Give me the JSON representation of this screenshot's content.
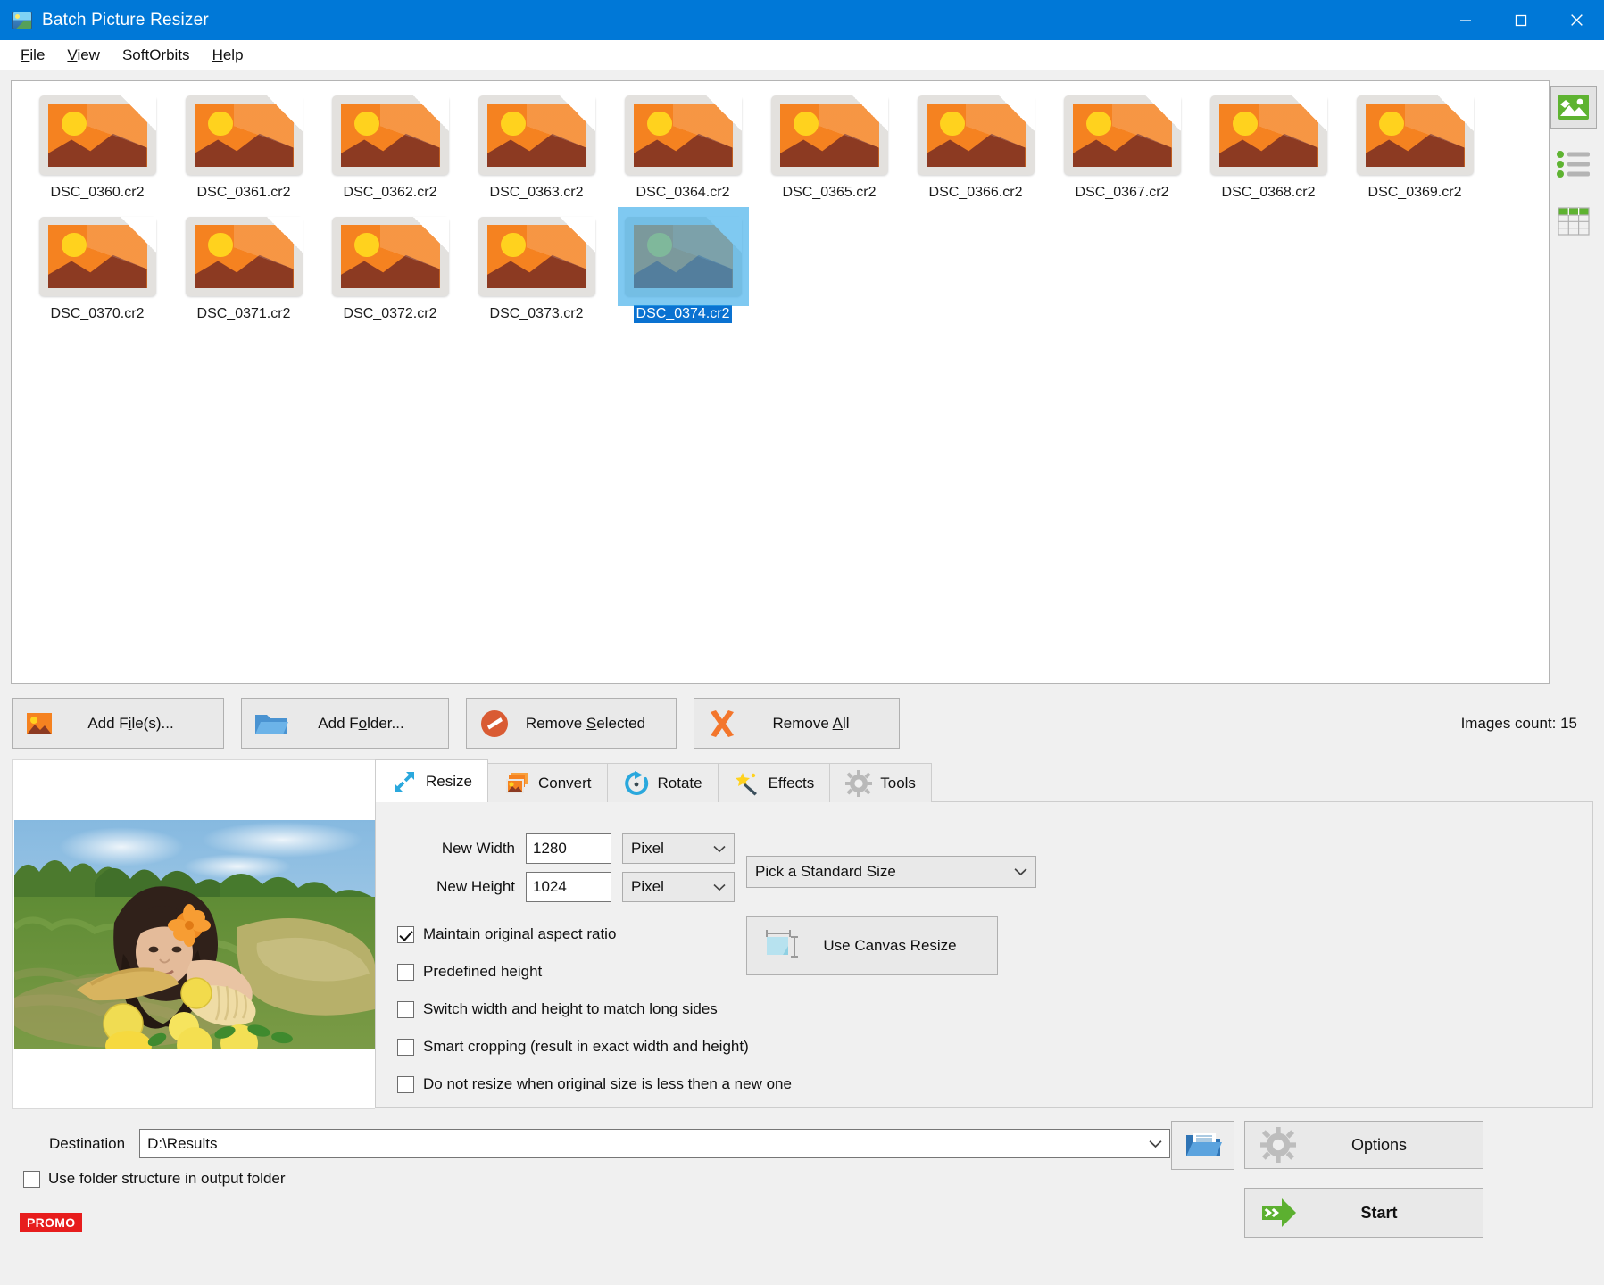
{
  "window": {
    "title": "Batch Picture Resizer",
    "app_icon": "app-picture-icon",
    "minimize": "minimize-icon",
    "maximize": "maximize-icon",
    "close": "close-icon"
  },
  "menu": {
    "items": [
      {
        "label": "File",
        "accel": "F"
      },
      {
        "label": "View",
        "accel": "V"
      },
      {
        "label": "SoftOrbits",
        "accel": ""
      },
      {
        "label": "Help",
        "accel": "H"
      }
    ]
  },
  "thumbnails": {
    "items": [
      {
        "label": "DSC_0360.cr2",
        "selected": false
      },
      {
        "label": "DSC_0361.cr2",
        "selected": false
      },
      {
        "label": "DSC_0362.cr2",
        "selected": false
      },
      {
        "label": "DSC_0363.cr2",
        "selected": false
      },
      {
        "label": "DSC_0364.cr2",
        "selected": false
      },
      {
        "label": "DSC_0365.cr2",
        "selected": false
      },
      {
        "label": "DSC_0366.cr2",
        "selected": false
      },
      {
        "label": "DSC_0367.cr2",
        "selected": false
      },
      {
        "label": "DSC_0368.cr2",
        "selected": false
      },
      {
        "label": "DSC_0369.cr2",
        "selected": false
      },
      {
        "label": "DSC_0370.cr2",
        "selected": false
      },
      {
        "label": "DSC_0371.cr2",
        "selected": false
      },
      {
        "label": "DSC_0372.cr2",
        "selected": false
      },
      {
        "label": "DSC_0373.cr2",
        "selected": false
      },
      {
        "label": "DSC_0374.cr2",
        "selected": true
      }
    ]
  },
  "view_modes": [
    {
      "name": "thumbnail-view",
      "icon": "image-icon",
      "active": true
    },
    {
      "name": "list-view",
      "icon": "list-icon",
      "active": false
    },
    {
      "name": "details-view",
      "icon": "table-icon",
      "active": false
    }
  ],
  "actions": {
    "add_files": "Add File(s)...",
    "add_folder": "Add Folder...",
    "remove_selected": "Remove Selected",
    "remove_all": "Remove All",
    "images_count": "Images count: 15"
  },
  "tabs": [
    {
      "label": "Resize",
      "icon": "resize-arrows-icon",
      "active": true
    },
    {
      "label": "Convert",
      "icon": "convert-images-icon",
      "active": false
    },
    {
      "label": "Rotate",
      "icon": "rotate-icon",
      "active": false
    },
    {
      "label": "Effects",
      "icon": "magic-wand-icon",
      "active": false
    },
    {
      "label": "Tools",
      "icon": "gear-icon",
      "active": false
    }
  ],
  "resize_panel": {
    "new_width_label": "New Width",
    "new_width_value": "1280",
    "new_width_unit": "Pixel",
    "new_height_label": "New Height",
    "new_height_value": "1024",
    "new_height_unit": "Pixel",
    "standard_size": "Pick a Standard Size",
    "canvas_resize": "Use Canvas Resize",
    "checkboxes": [
      {
        "label": "Maintain original aspect ratio",
        "checked": true
      },
      {
        "label": "Predefined height",
        "checked": false
      },
      {
        "label": "Switch width and height to match long sides",
        "checked": false
      },
      {
        "label": "Smart cropping (result in exact width and height)",
        "checked": false
      },
      {
        "label": "Do not resize when original size is less then a new one",
        "checked": false
      }
    ]
  },
  "bottom": {
    "destination_label": "Destination",
    "destination_value": "D:\\Results",
    "browse_icon": "open-folder-icon",
    "use_folder_structure": "Use folder structure in output folder",
    "use_folder_structure_checked": false,
    "options_label": "Options",
    "start_label": "Start",
    "promo_label": "PROMO"
  },
  "colors": {
    "titlebar": "#0078d7",
    "accent_orange": "#f58220",
    "selection_blue": "#0a72d1",
    "promo_red": "#e71d1d",
    "start_green": "#5cb030"
  }
}
